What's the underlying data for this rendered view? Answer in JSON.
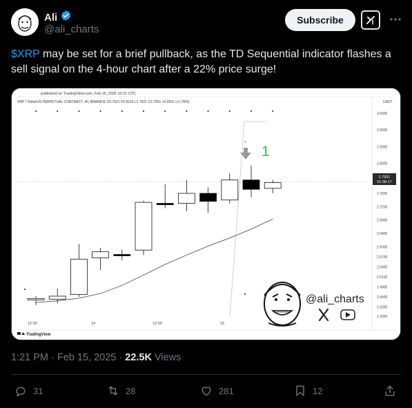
{
  "author": {
    "display_name": "Ali",
    "handle": "@ali_charts",
    "verified": true,
    "accent_color": "#1d9bf0"
  },
  "header": {
    "subscribe_label": "Subscribe",
    "grok_icon": "grok-icon",
    "more_icon": "more-dots-icon"
  },
  "tweet": {
    "cashtag": "$XRP",
    "text": " may be set for a brief pullback, as the TD Sequential indicator flashes a sell signal on the 4-hour chart after a 22% price surge!"
  },
  "chart_image": {
    "published_line": "published on TradingView.com, Feb 15, 2025 10:21 UTC",
    "symbol_line": "XRP / TetherUS PERPETUAL CONTRACT, 4h, BINANCE  O2.7621  H2.8116  L2.7621  C2.7951  +0.0331 (+1.20%)",
    "currency": "USDT",
    "price_labels": [
      "3.0000",
      "2.9500",
      "2.9000",
      "2.8500",
      "2.7600",
      "2.7200",
      "2.6800",
      "2.6400",
      "2.6000",
      "2.5700",
      "2.5400",
      "2.5100",
      "2.4800",
      "2.4500",
      "2.4200",
      "2.3920"
    ],
    "current_price": "2.7951",
    "countdown": "01:38:17",
    "time_labels": [
      "12:00",
      "14",
      "12:00",
      "15"
    ],
    "td_count": "1",
    "watermark_handle": "@ali_charts",
    "footer_brand": "TradingView",
    "price_scale": [
      2.392,
      3.0
    ],
    "candles": [
      {
        "o": 2.445,
        "h": 2.452,
        "l": 2.425,
        "c": 2.445
      },
      {
        "o": 2.443,
        "h": 2.475,
        "l": 2.43,
        "c": 2.452
      },
      {
        "o": 2.457,
        "h": 2.608,
        "l": 2.45,
        "c": 2.563
      },
      {
        "o": 2.567,
        "h": 2.597,
        "l": 2.53,
        "c": 2.585
      },
      {
        "o": 2.577,
        "h": 2.592,
        "l": 2.56,
        "c": 2.575
      },
      {
        "o": 2.59,
        "h": 2.738,
        "l": 2.575,
        "c": 2.733
      },
      {
        "o": 2.73,
        "h": 2.787,
        "l": 2.715,
        "c": 2.726
      },
      {
        "o": 2.73,
        "h": 2.8,
        "l": 2.706,
        "c": 2.76
      },
      {
        "o": 2.76,
        "h": 2.778,
        "l": 2.702,
        "c": 2.736
      },
      {
        "o": 2.74,
        "h": 2.82,
        "l": 2.73,
        "c": 2.8
      },
      {
        "o": 2.8,
        "h": 2.843,
        "l": 2.748,
        "c": 2.772
      },
      {
        "o": 2.775,
        "h": 2.8,
        "l": 2.76,
        "c": 2.792
      }
    ],
    "moving_average": [
      2.433,
      2.438,
      2.446,
      2.46,
      2.484,
      2.515,
      2.547,
      2.575,
      2.602,
      2.626,
      2.653,
      2.683
    ]
  },
  "footer": {
    "time": "1:21 PM",
    "date": "Feb 15, 2025",
    "views_count": "22.5K",
    "views_label": "Views"
  },
  "actions": {
    "replies": "31",
    "reposts": "28",
    "likes": "281",
    "bookmarks": "12"
  }
}
